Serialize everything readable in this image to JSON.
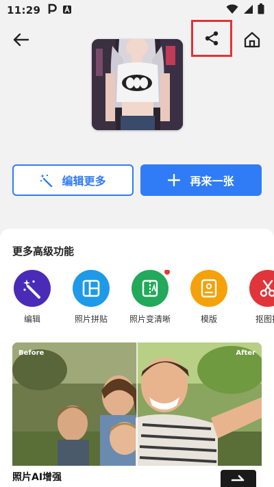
{
  "status_bar": {
    "time": "11:29"
  },
  "actions": {
    "edit_more_label": "编辑更多",
    "again_label": "再来一张"
  },
  "more_features": {
    "title": "更多高级功能",
    "items": [
      {
        "label": "编辑",
        "icon": "magic-wand-icon",
        "color": "#4a2bb8"
      },
      {
        "label": "照片拼贴",
        "icon": "collage-icon",
        "color": "#1e9ae8"
      },
      {
        "label": "照片变清晰",
        "icon": "sharpen-icon",
        "color": "#22a95a",
        "badge": true
      },
      {
        "label": "模版",
        "icon": "template-icon",
        "color": "#f5a10a"
      },
      {
        "label": "抠图换",
        "icon": "scissors-icon",
        "color": "#e0353a"
      }
    ]
  },
  "banner": {
    "before_label": "Before",
    "after_label": "After",
    "title": "照片AI增强"
  },
  "colors": {
    "accent": "#2f7cf6",
    "highlight_box": "#e23232"
  }
}
